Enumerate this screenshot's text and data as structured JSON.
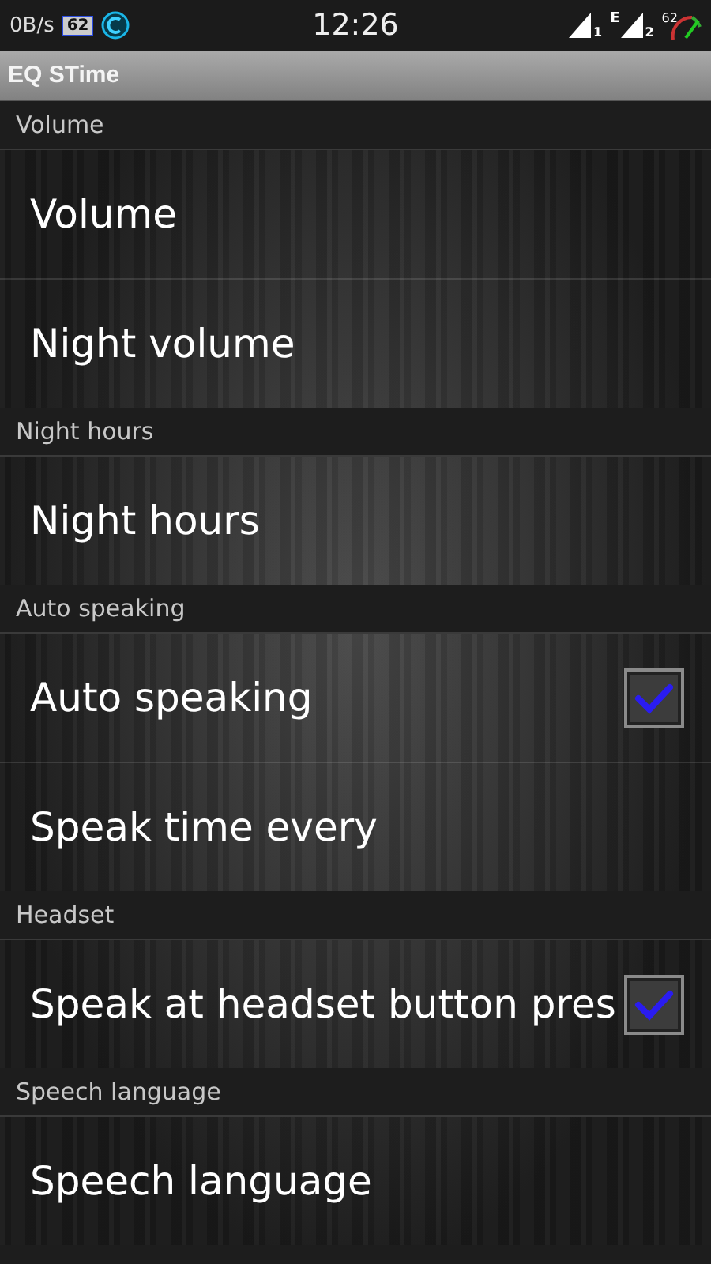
{
  "status_bar": {
    "speed": "0B/s",
    "badge": "62",
    "time": "12:26",
    "sim1": "1",
    "network": "E",
    "sim2": "2",
    "battery": "62"
  },
  "title_bar": {
    "title": "EQ STime"
  },
  "sections": [
    {
      "header": "Volume",
      "items": [
        {
          "kind": "plain",
          "label": "Volume"
        },
        {
          "kind": "plain",
          "label": "Night volume"
        }
      ]
    },
    {
      "header": "Night hours",
      "items": [
        {
          "kind": "plain",
          "label": "Night hours"
        }
      ]
    },
    {
      "header": "Auto speaking",
      "items": [
        {
          "kind": "checkbox",
          "label": "Auto speaking",
          "checked": true
        },
        {
          "kind": "plain",
          "label": "Speak time every"
        }
      ]
    },
    {
      "header": "Headset",
      "items": [
        {
          "kind": "checkbox",
          "label": "Speak at headset button pres",
          "checked": true
        }
      ]
    },
    {
      "header": "Speech language",
      "items": [
        {
          "kind": "plain",
          "label": "Speech language"
        }
      ]
    }
  ]
}
